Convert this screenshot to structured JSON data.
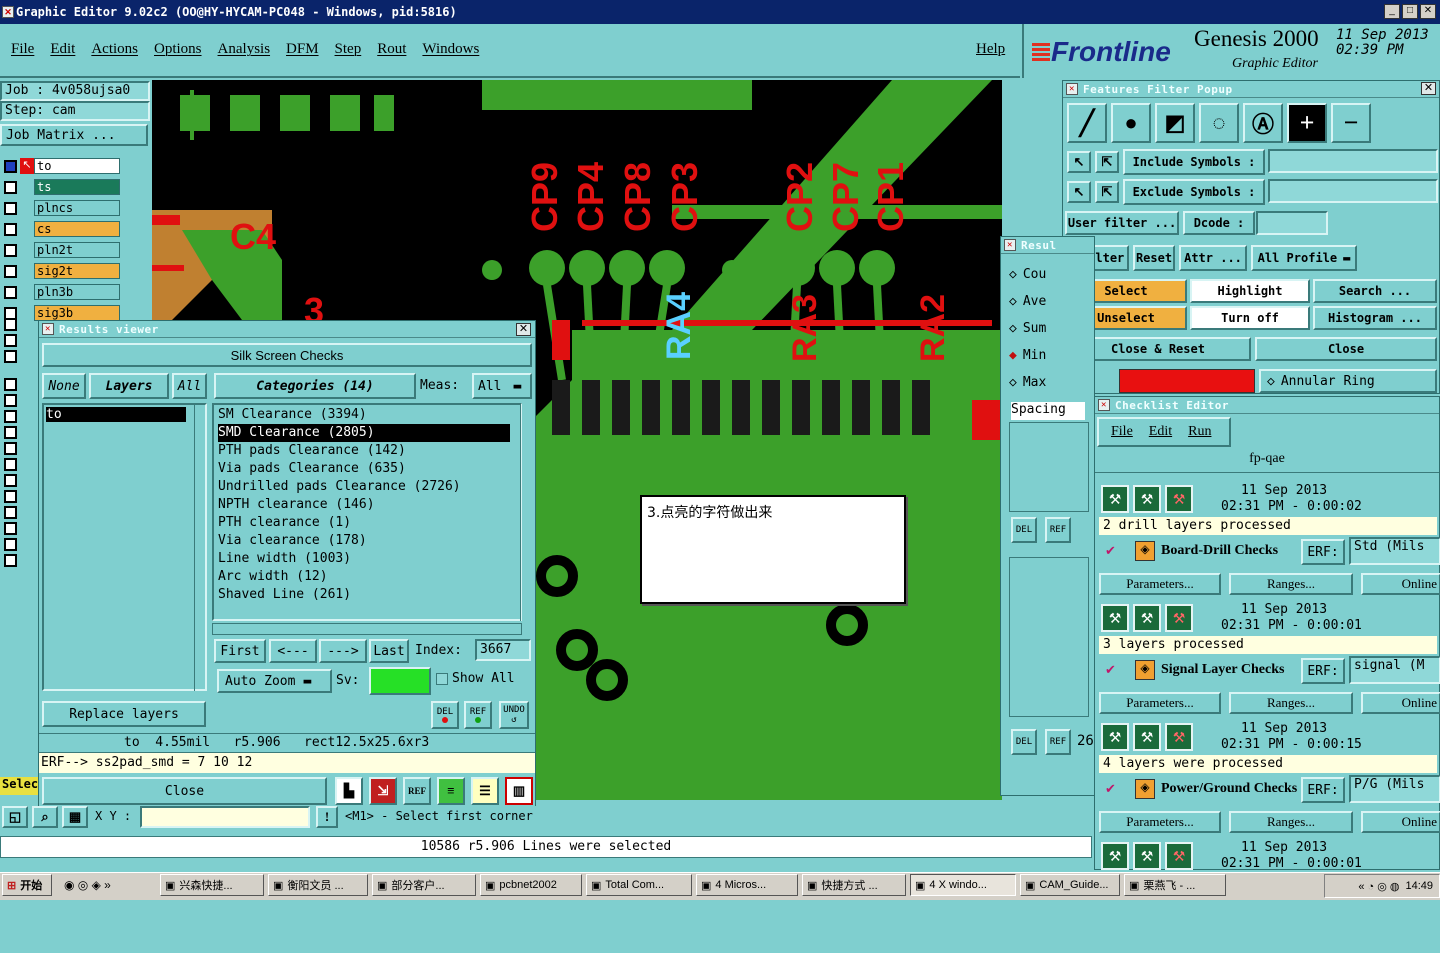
{
  "window": {
    "title": "Graphic Editor 9.02c2 (OO@HY-HYCAM-PC048 - Windows, pid:5816)"
  },
  "menu": [
    "File",
    "Edit",
    "Actions",
    "Options",
    "Analysis",
    "DFM",
    "Step",
    "Rout",
    "Windows"
  ],
  "help": "Help",
  "brand": {
    "logo": "Frontline",
    "product": "Genesis 2000",
    "subtitle": "Graphic Editor",
    "date": "11 Sep 2013",
    "time": "02:39 PM"
  },
  "job": {
    "job_label": "Job : 4v058ujsa0",
    "step_label": "Step: cam",
    "matrix": "Job Matrix ..."
  },
  "layers": [
    "to",
    "ts",
    "plncs",
    "cs",
    "pln2t",
    "sig2t",
    "pln3b",
    "sig3b"
  ],
  "canvas": {
    "labels": [
      "CP9",
      "CP4",
      "CP8",
      "CP3",
      "CP2",
      "CP7",
      "CP1",
      "C4",
      "RA3",
      "RA2",
      "RA4",
      "3"
    ],
    "note": "3.点亮的字符做出来"
  },
  "results_viewer": {
    "title": "Results viewer",
    "header": "Silk Screen Checks",
    "none": "None",
    "layers": "Layers",
    "all": "All",
    "categories": "Categories (14)",
    "meas_label": "Meas:",
    "meas_value": "All",
    "layer_list": [
      "to"
    ],
    "items": [
      "SM Clearance (3394)",
      "SMD Clearance (2805)",
      "PTH pads Clearance (142)",
      "Via pads Clearance (635)",
      "Undrilled pads Clearance (2726)",
      "NPTH clearance (146)",
      "PTH clearance (1)",
      "Via clearance (178)",
      "Line width (1003)",
      "Arc width (12)",
      "Shaved Line (261)"
    ],
    "selected_index": 1,
    "first": "First",
    "prev": "<---",
    "next": "--->",
    "last": "Last",
    "index_label": "Index:",
    "index_value": "3667",
    "auto_zoom": "Auto Zoom",
    "sv": "Sv:",
    "show_all": "Show All",
    "replace_layers": "Replace layers",
    "del": "DEL",
    "ref": "REF",
    "undo": "UNDO",
    "info": "to  4.55mil   r5.906   rect12.5x25.6xr3",
    "erf": "ERF--> ss2pad_smd = 7 10 12",
    "close": "Close"
  },
  "features_filter": {
    "title": "Features Filter Popup",
    "include": "Include Symbols :",
    "exclude": "Exclude Symbols :",
    "user_filter": "User filter ...",
    "dcode": "Dcode :",
    "filter": "Filter",
    "reset": "Reset",
    "attr": "Attr ...",
    "all_profile": "All Profile",
    "select": "Select",
    "highlight": "Highlight",
    "search": "Search ...",
    "unselect": "Unselect",
    "turn_off": "Turn off",
    "histogram": "Histogram ...",
    "close_reset": "Close & Reset",
    "close": "Close",
    "annular_ring": "Annular Ring"
  },
  "results_partial": {
    "title": "Resul",
    "options": [
      "Cou",
      "Ave",
      "Sum",
      "Min",
      "Max"
    ],
    "spacing": "Spacing",
    "num": "26"
  },
  "checklist": {
    "title": "Checklist Editor",
    "menu": [
      "File",
      "Edit",
      "Run"
    ],
    "name": "fp-qae",
    "entries": [
      {
        "date": "11 Sep 2013",
        "time": "02:31 PM - 0:00:02",
        "status": "2 drill layers processed",
        "name": "Board-Drill Checks",
        "erf": "ERF:",
        "erf_val": "Std (Mils",
        "params": "Parameters...",
        "ranges": "Ranges...",
        "online": "Online"
      },
      {
        "date": "11 Sep 2013",
        "time": "02:31 PM - 0:00:01",
        "status": "3 layers processed",
        "name": "Signal Layer Checks",
        "erf": "ERF:",
        "erf_val": "signal (M",
        "params": "Parameters...",
        "ranges": "Ranges...",
        "online": "Online"
      },
      {
        "date": "11 Sep 2013",
        "time": "02:31 PM - 0:00:15",
        "status": "4 layers were processed",
        "name": "Power/Ground Checks",
        "erf": "ERF:",
        "erf_val": "P/G (Mils",
        "params": "Parameters...",
        "ranges": "Ranges...",
        "online": "Online"
      },
      {
        "date": "11 Sep 2013",
        "time": "02:31 PM - 0:00:01"
      }
    ]
  },
  "bottom": {
    "xy_label": "X Y :",
    "hint": "<M1> - Select first corner",
    "status": "10586 r5.906 Lines were selected",
    "select_partial": "Selec"
  },
  "taskbar": {
    "start": "开始",
    "tasks": [
      "兴森快捷...",
      "衡阳文员 ...",
      "部分客户...",
      "pcbnet2002",
      "Total Com...",
      "4 Micros...",
      "快捷方式 ...",
      "4 X windo...",
      "CAM_Guide...",
      "栗燕飞 - ..."
    ],
    "clock": "14:49"
  }
}
